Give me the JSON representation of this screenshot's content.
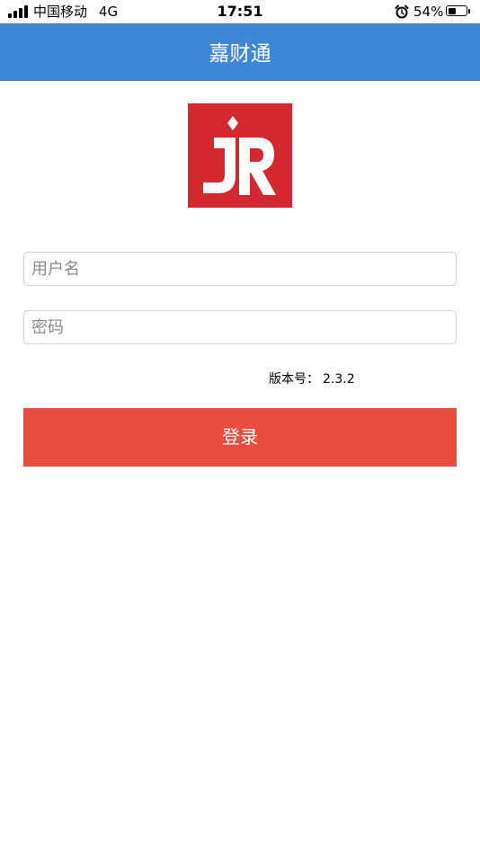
{
  "status_bar": {
    "carrier": "中国移动",
    "network": "4G",
    "time": "17:51",
    "battery_percent_label": "54%",
    "battery_level": 0.54,
    "icons": [
      "signal-icon",
      "alarm-icon",
      "battery-icon"
    ]
  },
  "nav": {
    "title": "嘉财通"
  },
  "logo": {
    "name": "jr-logo",
    "background_color": "#d3282f"
  },
  "form": {
    "username_placeholder": "用户名",
    "username_value": "",
    "password_placeholder": "密码",
    "password_value": ""
  },
  "version": {
    "label": "版本号：",
    "value": "2.3.2"
  },
  "login_button": {
    "label": "登录"
  },
  "colors": {
    "nav_background": "#3f86d8",
    "button_background": "#e84d3e",
    "logo_red": "#d3282f"
  }
}
